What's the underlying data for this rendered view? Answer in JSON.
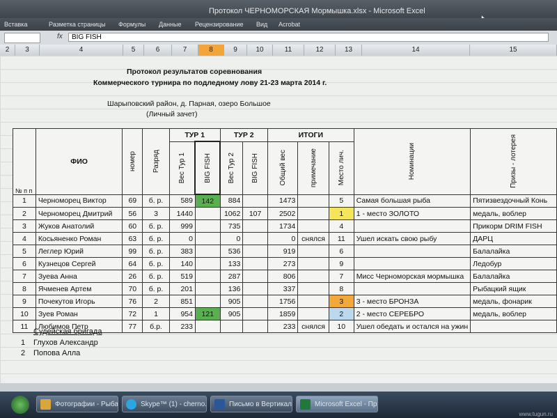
{
  "window": {
    "title": "Протокол ЧЕРНОМОРСКАЯ Мормышка.xlsx - Microsoft Excel"
  },
  "ribbon": {
    "tabs": [
      "Вставка",
      "Разметка страницы",
      "Формулы",
      "Данные",
      "Рецензирование",
      "Вид",
      "Acrobat"
    ]
  },
  "formula_bar": {
    "fx": "fx",
    "value": "BIG FISH"
  },
  "column_headers": [
    "2",
    "3",
    "4",
    "5",
    "6",
    "7",
    "8",
    "9",
    "10",
    "11",
    "12",
    "13",
    "14",
    "15"
  ],
  "selected_column": "8",
  "header_lines": {
    "line1": "Протокол результатов соревнования",
    "line2": "Коммерческого турнира по подледному лову 21-23 марта 2014 г.",
    "line3": "Шарыповский район, д. Парная, озеро Большое",
    "line4": "(Личный зачет)"
  },
  "table_headers": {
    "num": "№ п п",
    "fio": "ФИО",
    "nomer": "номер",
    "razryad": "Разряд",
    "tour1": "ТУР 1",
    "tour2": "ТУР 2",
    "itogi": "ИТОГИ",
    "ves_tur1": "Вес Тур 1",
    "bigfish1": "BIG FISH",
    "ves_tur2": "Вес Тур 2",
    "bigfish2": "BIG FISH",
    "obshiy": "Общий вес",
    "primechanie": "примечание",
    "mesto": "Место лич.",
    "nominacii": "Номинации",
    "prizy": "Призы - лотерея"
  },
  "rows": [
    {
      "n": "1",
      "fio": "Черноморец Виктор",
      "nomer": "69",
      "razryad": "б. р.",
      "t1": "589",
      "bf1": "142",
      "t2": "884",
      "bf2": "",
      "total": "1473",
      "note": "",
      "place": "5",
      "nom": "Самая большая рыба",
      "prize": "Пятизвездочный Конь"
    },
    {
      "n": "2",
      "fio": "Черноморец Дмитрий",
      "nomer": "56",
      "razryad": "3",
      "t1": "1440",
      "bf1": "",
      "t2": "1062",
      "bf2": "107",
      "total": "2502",
      "note": "",
      "place": "1",
      "nom": "1 - место ЗОЛОТО",
      "prize": "медаль, воблер"
    },
    {
      "n": "3",
      "fio": "Жуков Анатолий",
      "nomer": "60",
      "razryad": "б. р.",
      "t1": "999",
      "bf1": "",
      "t2": "735",
      "bf2": "",
      "total": "1734",
      "note": "",
      "place": "4",
      "nom": "",
      "prize": "Прикорм DRIM FISH"
    },
    {
      "n": "4",
      "fio": "Косьяненко Роман",
      "nomer": "63",
      "razryad": "б. р.",
      "t1": "0",
      "bf1": "",
      "t2": "0",
      "bf2": "",
      "total": "0",
      "note": "снялся",
      "place": "11",
      "nom": "Ушел искать свою рыбу",
      "prize": "ДАРЦ"
    },
    {
      "n": "5",
      "fio": "Леглер Юрий",
      "nomer": "99",
      "razryad": "б. р.",
      "t1": "383",
      "bf1": "",
      "t2": "536",
      "bf2": "",
      "total": "919",
      "note": "",
      "place": "6",
      "nom": "",
      "prize": "Балалайка"
    },
    {
      "n": "6",
      "fio": "Кузнецов Сергей",
      "nomer": "64",
      "razryad": "б. р.",
      "t1": "140",
      "bf1": "",
      "t2": "133",
      "bf2": "",
      "total": "273",
      "note": "",
      "place": "9",
      "nom": "",
      "prize": "Ледобур"
    },
    {
      "n": "7",
      "fio": "Зуева Анна",
      "nomer": "26",
      "razryad": "б. р.",
      "t1": "519",
      "bf1": "",
      "t2": "287",
      "bf2": "",
      "total": "806",
      "note": "",
      "place": "7",
      "nom": "Мисс Черноморская мормышка",
      "prize": "Балалайка"
    },
    {
      "n": "8",
      "fio": "Ячменев Артем",
      "nomer": "70",
      "razryad": "б. р.",
      "t1": "201",
      "bf1": "",
      "t2": "136",
      "bf2": "",
      "total": "337",
      "note": "",
      "place": "8",
      "nom": "",
      "prize": "Рыбацкий ящик"
    },
    {
      "n": "9",
      "fio": "Почекутов Игорь",
      "nomer": "76",
      "razryad": "2",
      "t1": "851",
      "bf1": "",
      "t2": "905",
      "bf2": "",
      "total": "1756",
      "note": "",
      "place": "3",
      "nom": "3 - место БРОНЗА",
      "prize": "медаль, фонарик"
    },
    {
      "n": "10",
      "fio": "Зуев Роман",
      "nomer": "72",
      "razryad": "1",
      "t1": "954",
      "bf1": "121",
      "t2": "905",
      "bf2": "",
      "total": "1859",
      "note": "",
      "place": "2",
      "nom": "2 - место СЕРЕБРО",
      "prize": "медаль, воблер"
    },
    {
      "n": "11",
      "fio": "Любимов Петр",
      "nomer": "77",
      "razryad": "б.р.",
      "t1": "233",
      "bf1": "",
      "t2": "",
      "bf2": "",
      "total": "233",
      "note": "снялся",
      "place": "10",
      "nom": "Ушел обедать и остался на ужин",
      "prize": ""
    }
  ],
  "judges": {
    "title": "Судейская бригада",
    "items": [
      {
        "n": "1",
        "name": "Глухов Александр"
      },
      {
        "n": "2",
        "name": "Попова Алла"
      }
    ]
  },
  "taskbar": {
    "items": [
      "Фотографии - Рыба...",
      "Skype™ (1) - cherno...",
      "Письмо в Вертикал...",
      "Microsoft Excel - Пр..."
    ]
  },
  "watermark": "www.tugun.ru"
}
